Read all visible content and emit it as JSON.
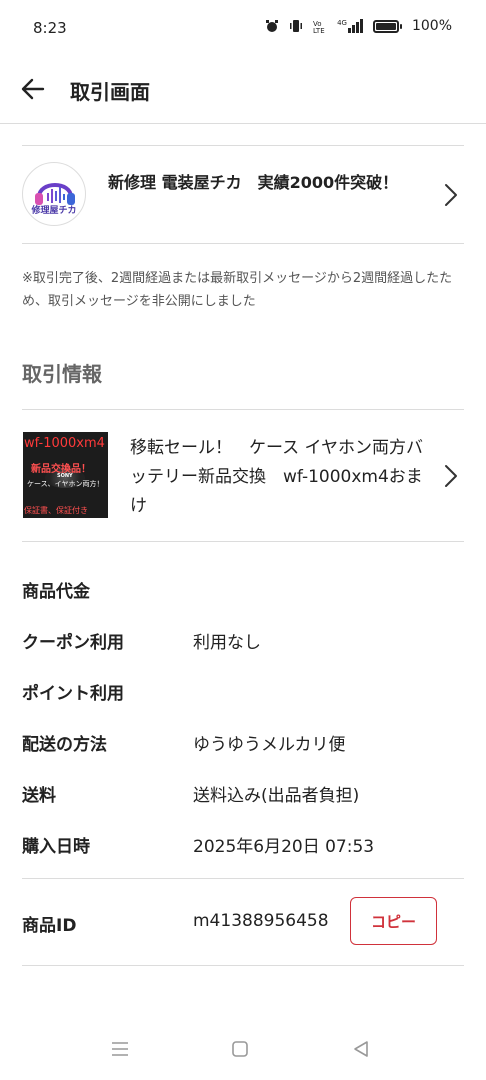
{
  "status_bar": {
    "time": "8:23",
    "network_label": "4G",
    "battery_percent": "100%"
  },
  "header": {
    "title": "取引画面",
    "back_icon": "arrow-left-icon"
  },
  "seller": {
    "name": "新修理 電装屋チカ　実績2000件突破！",
    "avatar_text": "修理屋チカ",
    "avatar_icon": "headphones-logo"
  },
  "notice": {
    "text": "※取引完了後、2週間経過または最新取引メッセージから2週間経過したため、取引メッセージを非公開にしました"
  },
  "transaction_section": {
    "title": "取引情報"
  },
  "product": {
    "title": "移転セール！　ケース イヤホン両方バッテリー新品交換　wf-1000xm4おまけ",
    "thumbnail": {
      "line1": "wf-1000xm4",
      "line2": "新品交換品！",
      "line3": "ケース、イヤホン両方！",
      "line4": "保証書、保証付き",
      "brand": "SONY"
    }
  },
  "info": {
    "price_label": "商品代金",
    "price_value": "",
    "coupon_label": "クーポン利用",
    "coupon_value": "利用なし",
    "points_label": "ポイント利用",
    "points_value": "",
    "shipping_method_label": "配送の方法",
    "shipping_method_value": "ゆうゆうメルカリ便",
    "shipping_fee_label": "送料",
    "shipping_fee_value": "送料込み(出品者負担)",
    "purchase_date_label": "購入日時",
    "purchase_date_value": "2025年6月20日 07:53",
    "item_id_label": "商品ID",
    "item_id_value": "m41388956458",
    "copy_label": "コピー"
  },
  "colors": {
    "accent": "#d0323b",
    "divider": "#dcdcdc",
    "muted_text": "#555555"
  }
}
